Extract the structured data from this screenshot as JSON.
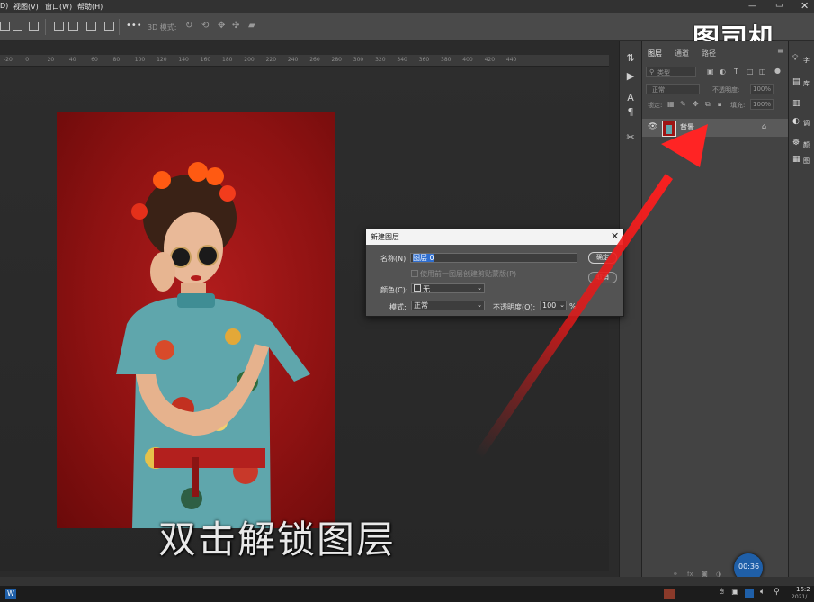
{
  "menubar": {
    "items": [
      "D)",
      "视图(V)",
      "窗口(W)",
      "帮助(H)"
    ]
  },
  "options": {
    "more": "•••",
    "mode_3d": "3D 模式:"
  },
  "ruler": {
    "ticks": [
      "-20",
      "0",
      "20",
      "40",
      "60",
      "80",
      "100",
      "120",
      "140",
      "160",
      "180",
      "200",
      "220",
      "240",
      "260",
      "280",
      "300",
      "320",
      "340",
      "360",
      "380",
      "400",
      "420",
      "440"
    ]
  },
  "watermark": "图司机",
  "layers_panel": {
    "tabs": [
      "图层",
      "通道",
      "路径"
    ],
    "filter_kind": "类型",
    "blend_mode": "正常",
    "opacity_label": "不透明度:",
    "opacity_value": "100%",
    "lock_label": "锁定:",
    "fill_label": "填充:",
    "fill_value": "100%",
    "layer_name": "背景"
  },
  "right_panel": {
    "items": [
      "字",
      "库",
      "调",
      "颜",
      "图"
    ]
  },
  "dialog": {
    "title": "新建图层",
    "name_label": "名称(N):",
    "name_value": "图层 0",
    "clip_label": "使用前一图层创建剪贴蒙版(P)",
    "color_label": "颜色(C):",
    "color_value": "无",
    "mode_label": "模式:",
    "mode_value": "正常",
    "opacity_label": "不透明度(O):",
    "opacity_value": "100",
    "percent": "%",
    "ok": "确定",
    "cancel": "取消"
  },
  "subtitle": "双击解锁图层",
  "timer": "00:36",
  "taskbar": {
    "time": "16:2",
    "date": "2021/"
  },
  "colors": {
    "arrow": "#e01818",
    "photo_bg": "#9e1414",
    "timer_badge": "#1f5fa8"
  }
}
